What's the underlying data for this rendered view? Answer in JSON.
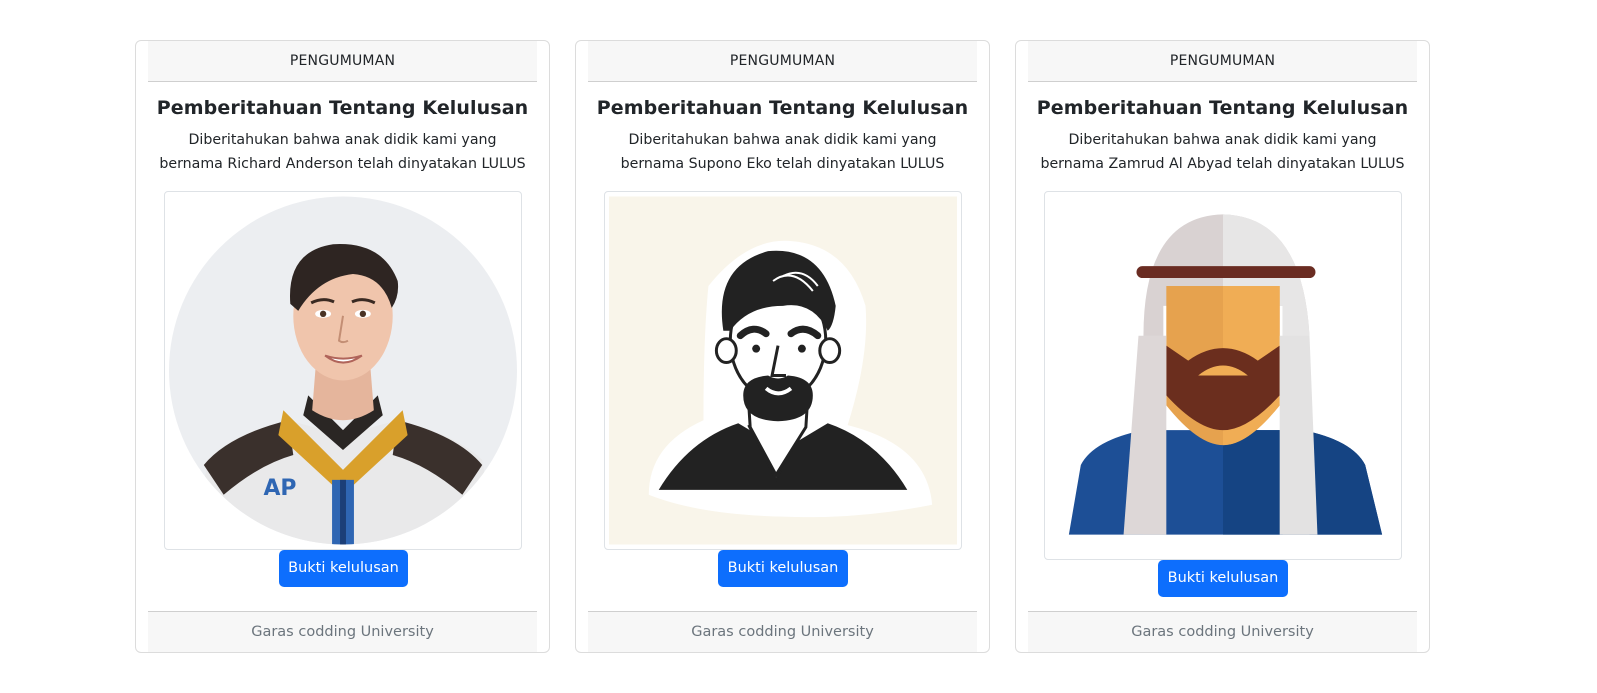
{
  "cards": [
    {
      "header": "PENGUMUMAN",
      "title": "Pemberitahuan Tentang Kelulusan",
      "text_line1": "Diberitahukan bahwa anak didik kami yang",
      "text_line2": "bernama Richard Anderson telah dinyatakan LULUS",
      "image": "avatar-young-man-cartoon",
      "button": "Bukti kelulusan",
      "footer": "Garas codding University"
    },
    {
      "header": "PENGUMUMAN",
      "title": "Pemberitahuan Tentang Kelulusan",
      "text_line1": "Diberitahukan bahwa anak didik kami yang",
      "text_line2": "bernama Supono Eko telah dinyatakan LULUS",
      "image": "avatar-bearded-man-sticker",
      "button": "Bukti kelulusan",
      "footer": "Garas codding University"
    },
    {
      "header": "PENGUMUMAN",
      "title": "Pemberitahuan Tentang Kelulusan",
      "text_line1": "Diberitahukan bahwa anak didik kami yang",
      "text_line2": "bernama Zamrud Al Abyad telah dinyatakan LULUS",
      "image": "avatar-man-keffiyeh",
      "button": "Bukti kelulusan",
      "footer": "Garas codding University"
    }
  ],
  "colors": {
    "button": "#0d6efd",
    "header_bg": "#f7f7f7",
    "border": "#dcdcdc",
    "footer_text": "#6c757d"
  }
}
